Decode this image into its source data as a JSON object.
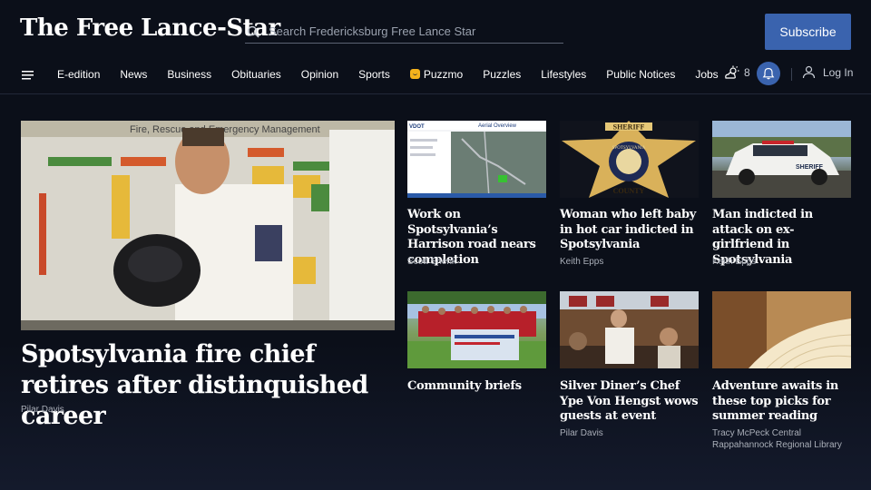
{
  "header": {
    "logo": "The Free Lance-Star",
    "search_placeholder": "Search Fredericksburg Free Lance Star",
    "subscribe_label": "Subscribe"
  },
  "nav": {
    "items": [
      "E-edition",
      "News",
      "Business",
      "Obituaries",
      "Opinion",
      "Sports",
      "Puzzmo",
      "Puzzles",
      "Lifestyles",
      "Public Notices",
      "Jobs"
    ],
    "weather_text": "8",
    "login_label": "Log In"
  },
  "articles": {
    "main": {
      "headline": "Spotsylvania fire chief retires after distinquished career",
      "byline": "Pilar Davis"
    },
    "a1": {
      "headline": "Work on Spotsylvania’s Harrison road nears completion",
      "byline": "Scott Shenk"
    },
    "a2": {
      "headline": "Woman who left baby in hot car indicted in Spotsylvania",
      "byline": "Keith Epps"
    },
    "a3": {
      "headline": "Man indicted in attack on ex-girlfriend in Spotsylvania",
      "byline": "Keith Epps"
    },
    "a4": {
      "headline": "Community briefs",
      "byline": ""
    },
    "a5": {
      "headline": "Silver Diner’s Chef Ype Von Hengst wows guests at event",
      "byline": "Pilar Davis"
    },
    "a6": {
      "headline": "Adventure awaits in these top picks for summer reading",
      "byline": "Tracy McPeck Central Rappahannock Regional Library"
    }
  },
  "image_text": {
    "fire_board": "Fire, Rescue and Emergency Management",
    "map_title": "Aerial Overview",
    "map_brand": "VDOT",
    "badge_top": "SHERIFF",
    "badge_mid": "SPOTSYLVANIA",
    "badge_bottom": "COUNTY",
    "car_text": "SHERIFF"
  },
  "colors": {
    "background": "#0b0f19",
    "accent": "#3a63ae",
    "byline": "#a9aeb8"
  }
}
